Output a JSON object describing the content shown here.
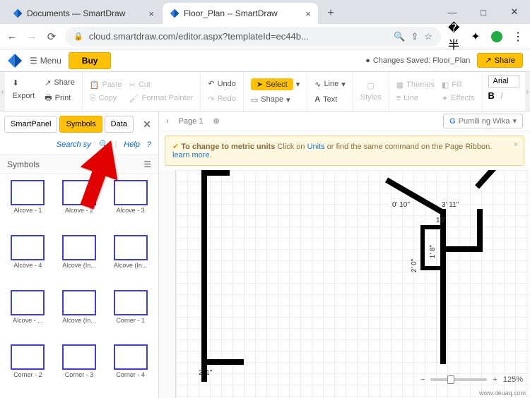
{
  "browser": {
    "tabs": [
      {
        "title": "Documents — SmartDraw"
      },
      {
        "title": "Floor_Plan -- SmartDraw"
      }
    ],
    "url_display": "cloud.smartdraw.com/editor.aspx?templateId=ec44b..."
  },
  "app": {
    "menu_label": "Menu",
    "buy_label": "Buy",
    "save_status": "Changes Saved: Floor_Plan",
    "share_label": "Share"
  },
  "ribbon": {
    "export": "Export",
    "share": "Share",
    "print": "Print",
    "paste": "Paste",
    "copy": "Copy",
    "cut": "Cut",
    "format_painter": "Format Painter",
    "undo": "Undo",
    "redo": "Redo",
    "select": "Select",
    "shape": "Shape",
    "line": "Line",
    "text": "Text",
    "styles": "Styles",
    "themes": "Themes",
    "line2": "Line",
    "fill": "Fill",
    "effects": "Effects",
    "font_name": "Arial",
    "bold": "B",
    "italic": "I"
  },
  "panel": {
    "tabs": {
      "smartpanel": "SmartPanel",
      "symbols": "Symbols",
      "data": "Data"
    },
    "search_label": "Search sy",
    "help_label": "Help",
    "header": "Symbols",
    "items": [
      "Alcove - 1",
      "Alcove - 2",
      "Alcove - 3",
      "Alcove - 4",
      "Alcove (In...",
      "Alcove (In...",
      "Alcove - ...",
      "Alcove (In...",
      "Corner - 1",
      "Corner - 2",
      "Corner - 3",
      "Corner - 4"
    ]
  },
  "canvas": {
    "page_label": "Page 1",
    "lang_button": "Pumili ng Wika",
    "banner_bold": "To change to metric units",
    "banner_t1": "Click on",
    "banner_link1": "Units",
    "banner_t2": "or find the same command on the Page Ribbon.",
    "banner_link2": "learn more",
    "dims": {
      "a": "0' 10\"",
      "b": "3' 11\"",
      "c": "10\"",
      "d": "2' 0\"",
      "e": "1' 8\"",
      "f": "2' 1\""
    },
    "zoom": "125%",
    "watermark": "www.deuaq.com"
  }
}
